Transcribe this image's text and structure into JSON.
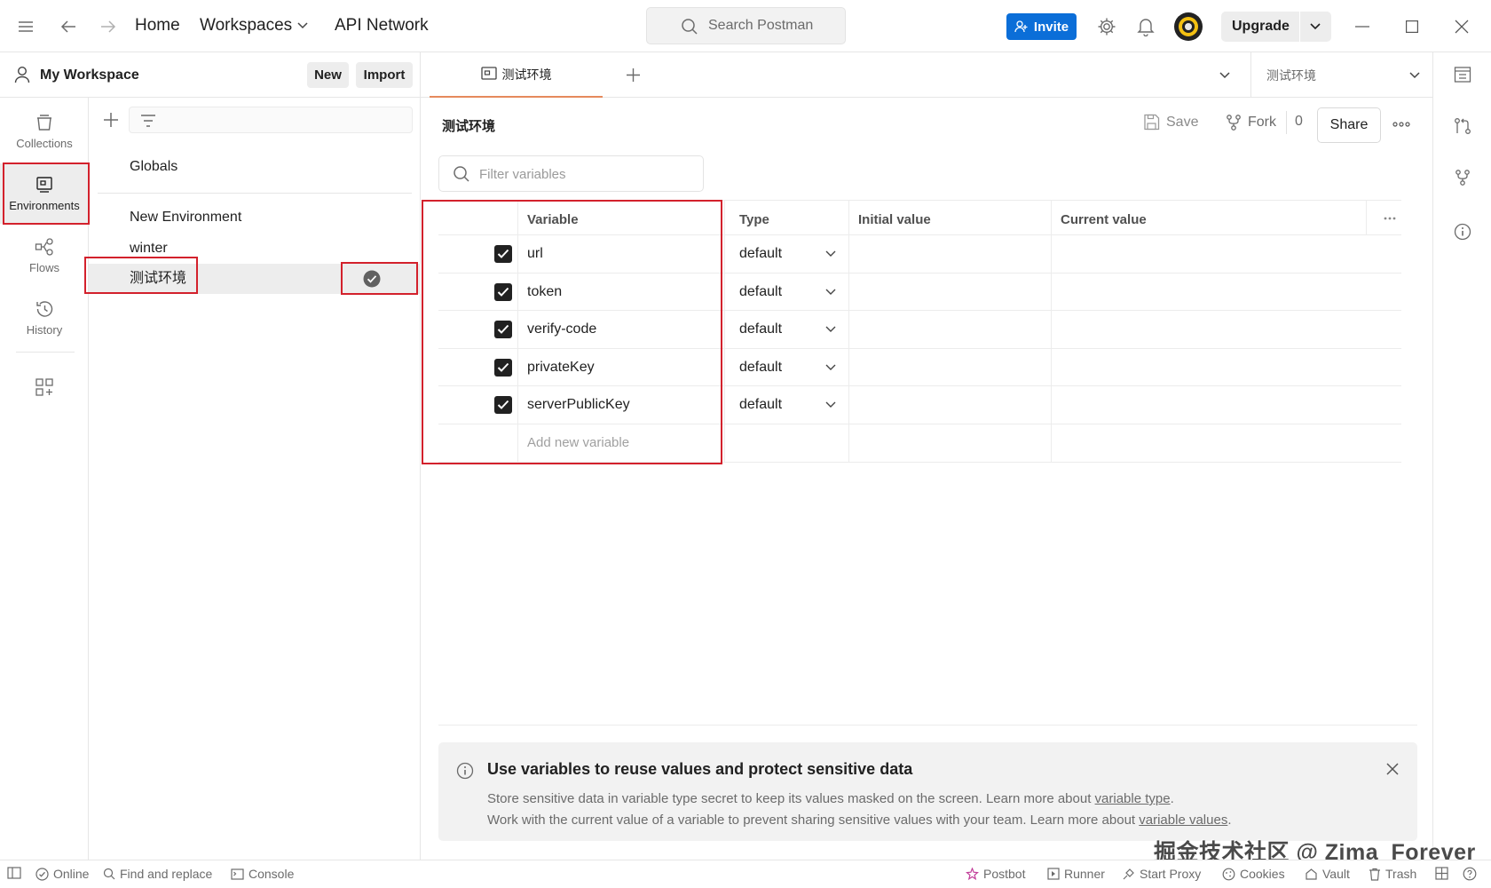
{
  "topbar": {
    "nav": {
      "home": "Home",
      "workspaces": "Workspaces",
      "api_network": "API Network"
    },
    "search_placeholder": "Search Postman",
    "invite_label": "Invite",
    "upgrade_label": "Upgrade"
  },
  "workspace": {
    "title": "My Workspace",
    "new_label": "New",
    "import_label": "Import"
  },
  "rail": {
    "items": [
      {
        "label": "Collections",
        "icon": "collections-icon"
      },
      {
        "label": "Environments",
        "icon": "environments-icon"
      },
      {
        "label": "Flows",
        "icon": "flows-icon"
      },
      {
        "label": "History",
        "icon": "history-icon"
      }
    ]
  },
  "env_list": {
    "globals": "Globals",
    "items": [
      "New Environment",
      "winter",
      "测试环境"
    ],
    "active_index": 2
  },
  "tabs": {
    "active_tab": "测试环境",
    "env_selector": "测试环境"
  },
  "editor": {
    "title": "测试环境",
    "save_label": "Save",
    "fork_label": "Fork",
    "fork_count": "0",
    "share_label": "Share",
    "filter_placeholder": "Filter variables",
    "columns": {
      "variable": "Variable",
      "type": "Type",
      "initial": "Initial value",
      "current": "Current value"
    },
    "rows": [
      {
        "name": "url",
        "type": "default",
        "enabled": true,
        "initial": "",
        "current": ""
      },
      {
        "name": "token",
        "type": "default",
        "enabled": true,
        "initial": "",
        "current": ""
      },
      {
        "name": "verify-code",
        "type": "default",
        "enabled": true,
        "initial": "",
        "current": ""
      },
      {
        "name": "privateKey",
        "type": "default",
        "enabled": true,
        "initial": "",
        "current": ""
      },
      {
        "name": "serverPublicKey",
        "type": "default",
        "enabled": true,
        "initial": "",
        "current": ""
      }
    ],
    "add_placeholder": "Add new variable"
  },
  "banner": {
    "title": "Use variables to reuse values and protect sensitive data",
    "line1_prefix": "Store sensitive data in variable type secret to keep its values masked on the screen. Learn more about ",
    "line1_link": "variable type",
    "line1_suffix": ".",
    "line2_prefix": "Work with the current value of a variable to prevent sharing sensitive values with your team. Learn more about ",
    "line2_link": "variable values",
    "line2_suffix": "."
  },
  "statusbar": {
    "online": "Online",
    "find_replace": "Find and replace",
    "console": "Console",
    "postbot": "Postbot",
    "runner": "Runner",
    "start_proxy": "Start Proxy",
    "cookies": "Cookies",
    "vault": "Vault",
    "trash": "Trash"
  },
  "watermark": "掘金技术社区 @ Zima_Forever",
  "colors": {
    "accent": "#0b6ed8",
    "tab_underline": "#e58a5c",
    "annotation": "#d3212c",
    "postbot": "#c2409a"
  }
}
